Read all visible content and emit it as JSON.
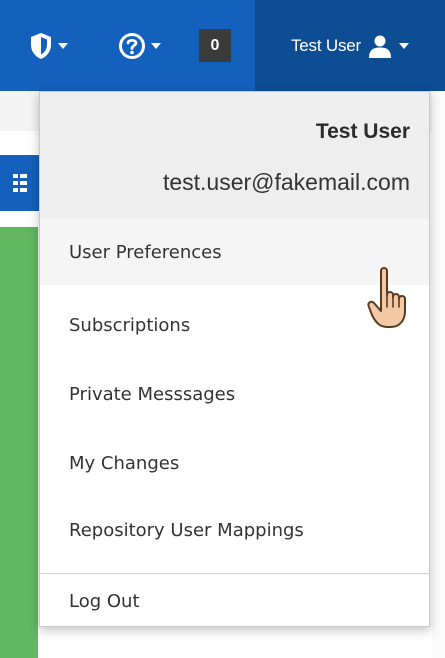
{
  "topbar": {
    "shield_icon": "shield-icon",
    "help_icon": "help-circle-icon",
    "counter": "0",
    "user_label": "Test User",
    "user_icon": "user-icon"
  },
  "menu": {
    "header": {
      "name": "Test User",
      "email": "test.user@fakemail.com"
    },
    "items": [
      {
        "label": "User Preferences",
        "hovered": true
      },
      {
        "label": "Subscriptions"
      },
      {
        "label": "Private Messsages"
      },
      {
        "label": "My Changes"
      },
      {
        "label": "Repository User Mappings"
      }
    ],
    "logout": {
      "label": "Log Out"
    }
  },
  "colors": {
    "nav_blue": "#1461bd",
    "nav_blue_dark": "#0d4d94",
    "sidebar_green": "#62b760",
    "counter_bg": "#3b3b3b"
  }
}
